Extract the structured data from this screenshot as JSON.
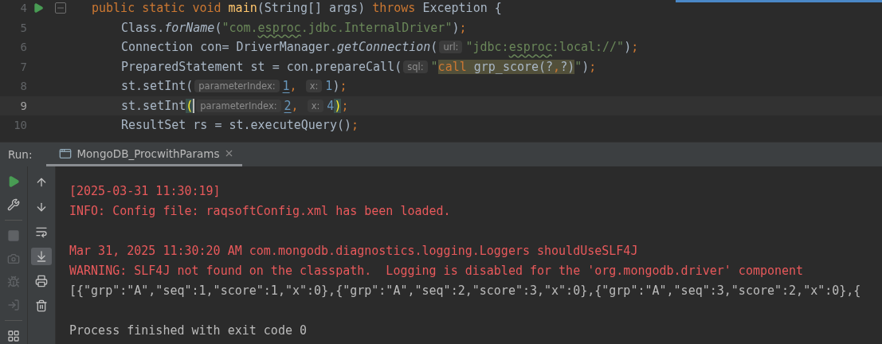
{
  "editor": {
    "lines": [
      {
        "number": "4",
        "current": false,
        "runnable": true,
        "foldable": true,
        "tokens": [
          {
            "kind": "kw",
            "text": "public static void "
          },
          {
            "kind": "fn",
            "text": "main"
          },
          {
            "kind": "plain",
            "text": "(String[] args) "
          },
          {
            "kind": "kw",
            "text": "throws "
          },
          {
            "kind": "plain",
            "text": "Exception {"
          }
        ],
        "children": [
          {
            "number": "5",
            "current": false,
            "tokens": [
              {
                "kind": "plain",
                "text": "Class."
              },
              {
                "kind": "italic",
                "text": "forName"
              },
              {
                "kind": "plain",
                "text": "("
              },
              {
                "kind": "str",
                "text": "\"com."
              },
              {
                "kind": "str_typo",
                "text": "esproc"
              },
              {
                "kind": "str",
                "text": ".jdbc.InternalDriver\""
              },
              {
                "kind": "plain",
                "text": ")"
              },
              {
                "kind": "punct",
                "text": ";"
              }
            ]
          },
          {
            "number": "6",
            "current": false,
            "tokens": [
              {
                "kind": "plain",
                "text": "Connection con= DriverManager."
              },
              {
                "kind": "italic",
                "text": "getConnection"
              },
              {
                "kind": "plain",
                "text": "("
              },
              {
                "kind": "hint",
                "text": "url:"
              },
              {
                "kind": "str",
                "text": "\"jdbc:"
              },
              {
                "kind": "str_typo",
                "text": "esproc"
              },
              {
                "kind": "str",
                "text": ":local://\""
              },
              {
                "kind": "plain",
                "text": ")"
              },
              {
                "kind": "punct",
                "text": ";"
              }
            ]
          },
          {
            "number": "7",
            "current": false,
            "tokens": [
              {
                "kind": "plain",
                "text": "PreparedStatement st = con.prepareCall("
              },
              {
                "kind": "hint",
                "text": "sql:"
              },
              {
                "kind": "str",
                "text": "\""
              },
              {
                "kind": "hl_kw",
                "text": "call"
              },
              {
                "kind": "hl",
                "text": " grp_score(?"
              },
              {
                "kind": "hl_kw",
                "text": ","
              },
              {
                "kind": "hl",
                "text": "?)"
              },
              {
                "kind": "str",
                "text": "\""
              },
              {
                "kind": "plain",
                "text": ")"
              },
              {
                "kind": "punct",
                "text": ";"
              }
            ]
          },
          {
            "number": "8",
            "current": false,
            "tokens": [
              {
                "kind": "plain",
                "text": "st.setInt("
              },
              {
                "kind": "hint",
                "text": "parameterIndex:"
              },
              {
                "kind": "num_link",
                "text": "1"
              },
              {
                "kind": "punct",
                "text": ", "
              },
              {
                "kind": "hint",
                "text": "x:"
              },
              {
                "kind": "num",
                "text": "1"
              },
              {
                "kind": "plain",
                "text": ")"
              },
              {
                "kind": "punct",
                "text": ";"
              }
            ]
          },
          {
            "number": "9",
            "current": true,
            "tokens": [
              {
                "kind": "plain",
                "text": "st.setInt"
              },
              {
                "kind": "brace",
                "text": "(",
                "caret": true
              },
              {
                "kind": "hint",
                "text": "parameterIndex:"
              },
              {
                "kind": "num_link",
                "text": "2"
              },
              {
                "kind": "punct",
                "text": ", "
              },
              {
                "kind": "hint",
                "text": "x:"
              },
              {
                "kind": "num",
                "text": "4"
              },
              {
                "kind": "brace",
                "text": ")"
              },
              {
                "kind": "punct",
                "text": ";"
              }
            ]
          },
          {
            "number": "10",
            "current": false,
            "tokens": [
              {
                "kind": "plain",
                "text": "ResultSet rs = st.executeQuery()"
              },
              {
                "kind": "punct",
                "text": ";"
              }
            ]
          }
        ]
      }
    ]
  },
  "run_panel": {
    "label": "Run:",
    "tab": {
      "title": "MongoDB_ProcwithParams",
      "selected": true
    }
  },
  "run_tools": [
    {
      "kind": "run",
      "disabled": false
    },
    {
      "kind": "wrench",
      "disabled": false
    },
    {
      "kind": "stop",
      "disabled": true
    },
    {
      "kind": "camera",
      "disabled": true
    },
    {
      "kind": "bug",
      "disabled": true
    },
    {
      "kind": "login",
      "disabled": true
    },
    {
      "kind": "layout",
      "disabled": false
    }
  ],
  "console_tools": [
    {
      "kind": "up",
      "selected": false
    },
    {
      "kind": "down",
      "selected": false
    },
    {
      "kind": "wrap",
      "selected": false
    },
    {
      "kind": "scroll_end",
      "selected": true
    },
    {
      "kind": "print",
      "selected": false
    },
    {
      "kind": "trash",
      "selected": false
    }
  ],
  "console": {
    "blocks": [
      [
        {
          "kind": "error",
          "text": "[2025-03-31 11:30:19]"
        },
        {
          "kind": "error",
          "text": "INFO: Config file: raqsoftConfig.xml has been loaded."
        }
      ],
      [
        {
          "kind": "error",
          "text": "Mar 31, 2025 11:30:20 AM com.mongodb.diagnostics.logging.Loggers shouldUseSLF4J"
        },
        {
          "kind": "error",
          "text": "WARNING: SLF4J not found on the classpath.  Logging is disabled for the 'org.mongodb.driver' component"
        },
        {
          "kind": "output",
          "text": "[{\"grp\":\"A\",\"seq\":1,\"score\":1,\"x\":0},{\"grp\":\"A\",\"seq\":2,\"score\":3,\"x\":0},{\"grp\":\"A\",\"seq\":3,\"score\":2,\"x\":0},{"
        }
      ],
      [
        {
          "kind": "output",
          "text": "Process finished with exit code 0"
        }
      ]
    ]
  }
}
